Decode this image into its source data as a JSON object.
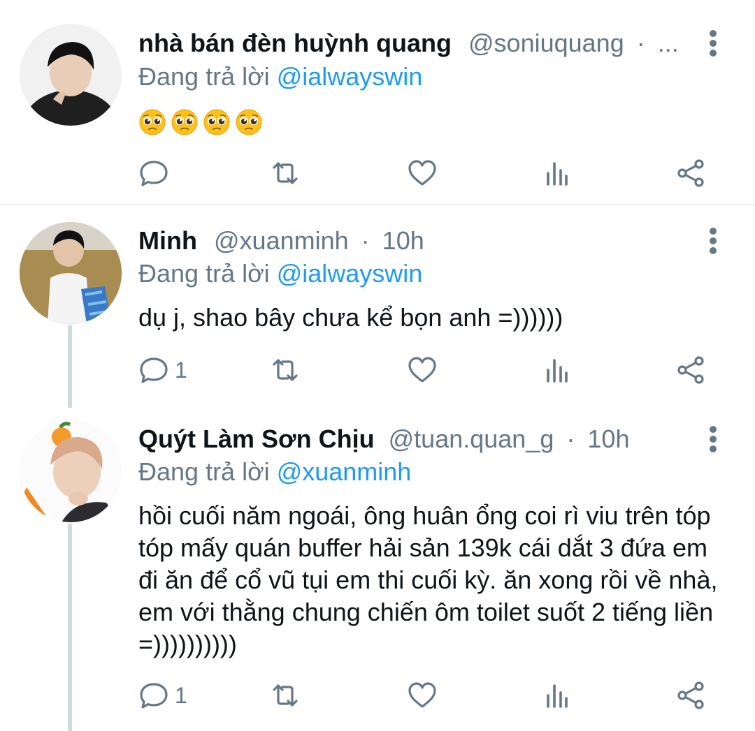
{
  "tweets": [
    {
      "name": "nhà bán đèn huỳnh quang",
      "handle": "@soniuquang",
      "separator": "·",
      "time": "...",
      "replying_prefix": "Đang trả lời ",
      "replying_to": "@ialwayswin",
      "body": "",
      "emoji_count": 4,
      "reply_count": "",
      "avatar_icon": "avatar-dark-hair-hoodie"
    },
    {
      "name": "Minh",
      "handle": "@xuanminh",
      "separator": "·",
      "time": "10h",
      "replying_prefix": "Đang trả lời ",
      "replying_to": "@ialwayswin",
      "body": "dụ j, shao bây chưa kể bọn anh =))))))",
      "reply_count": "1",
      "avatar_icon": "avatar-outdoor-field"
    },
    {
      "name": "Quýt Làm Sơn Chịu",
      "handle": "@tuan.quan_g",
      "separator": "·",
      "time": "10h",
      "replying_prefix": "Đang trả lời ",
      "replying_to": "@xuanminh",
      "body": "hồi cuối năm ngoái, ông huân ổng coi rì viu trên tóp tóp mấy quán buffer hải sản 139k cái dắt 3 đứa em đi ăn để cổ vũ tụi em thi cuối kỳ. ăn xong rồi về nhà, em với thằng chung chiến ôm toilet suốt 2 tiếng liền =))))))))))",
      "reply_count": "1",
      "avatar_icon": "avatar-orange-hat"
    }
  ],
  "icons": {
    "reply": "reply-icon",
    "retweet": "retweet-icon",
    "like": "like-icon",
    "analytics": "analytics-icon",
    "share": "share-icon",
    "more": "more-icon"
  },
  "colors": {
    "text": "#0f1419",
    "secondary": "#657786",
    "accent": "#1d9bf0",
    "divider": "#e6ecf0",
    "thread_line": "#cfd9de"
  }
}
